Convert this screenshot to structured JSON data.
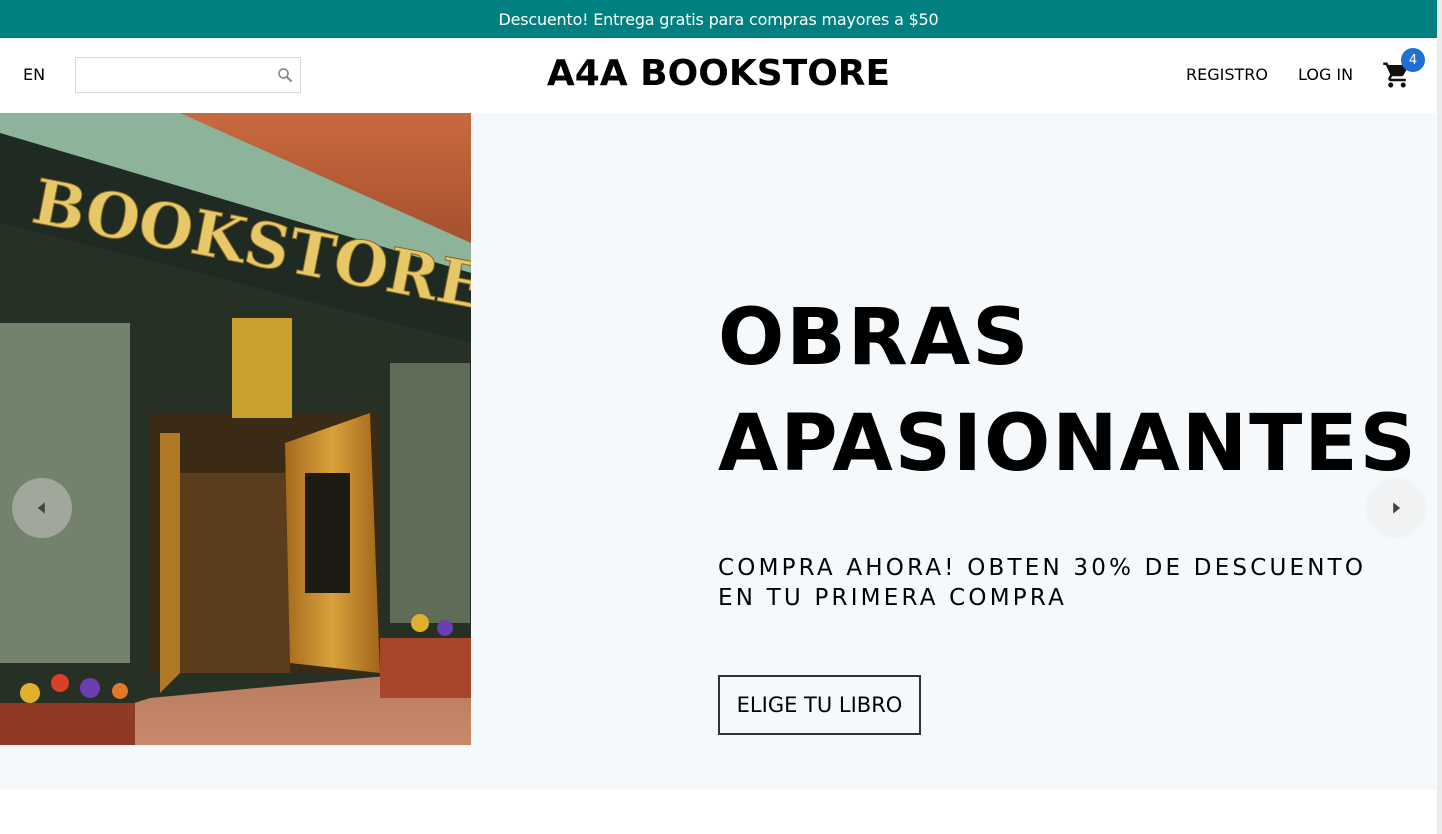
{
  "announcement": {
    "text": "Descuento! Entrega gratis para compras mayores a $50"
  },
  "nav": {
    "language": "EN",
    "search": {
      "placeholder": "",
      "icon": "search-icon"
    },
    "logo": "A4A BOOKSTORE",
    "links": {
      "register": "REGISTRO",
      "login": "LOG IN"
    },
    "cart": {
      "icon": "shopping-cart-icon",
      "count": "4"
    }
  },
  "hero": {
    "image_sign": "BOOKSTORE",
    "title_lines": [
      "OBRAS",
      "APASIONANTES"
    ],
    "subtitle_lines": [
      "COMPRA AHORA! OBTEN 30% DE DESCUENTO",
      "EN TU PRIMERA COMPRA"
    ],
    "cta": "ELIGE TU LIBRO",
    "arrows": {
      "prev": "arrow-left-icon",
      "next": "arrow-right-icon"
    }
  },
  "colors": {
    "announcement_bg": "#008080",
    "hero_bg": "#f5f9fb",
    "badge": "#1e6fd6"
  }
}
